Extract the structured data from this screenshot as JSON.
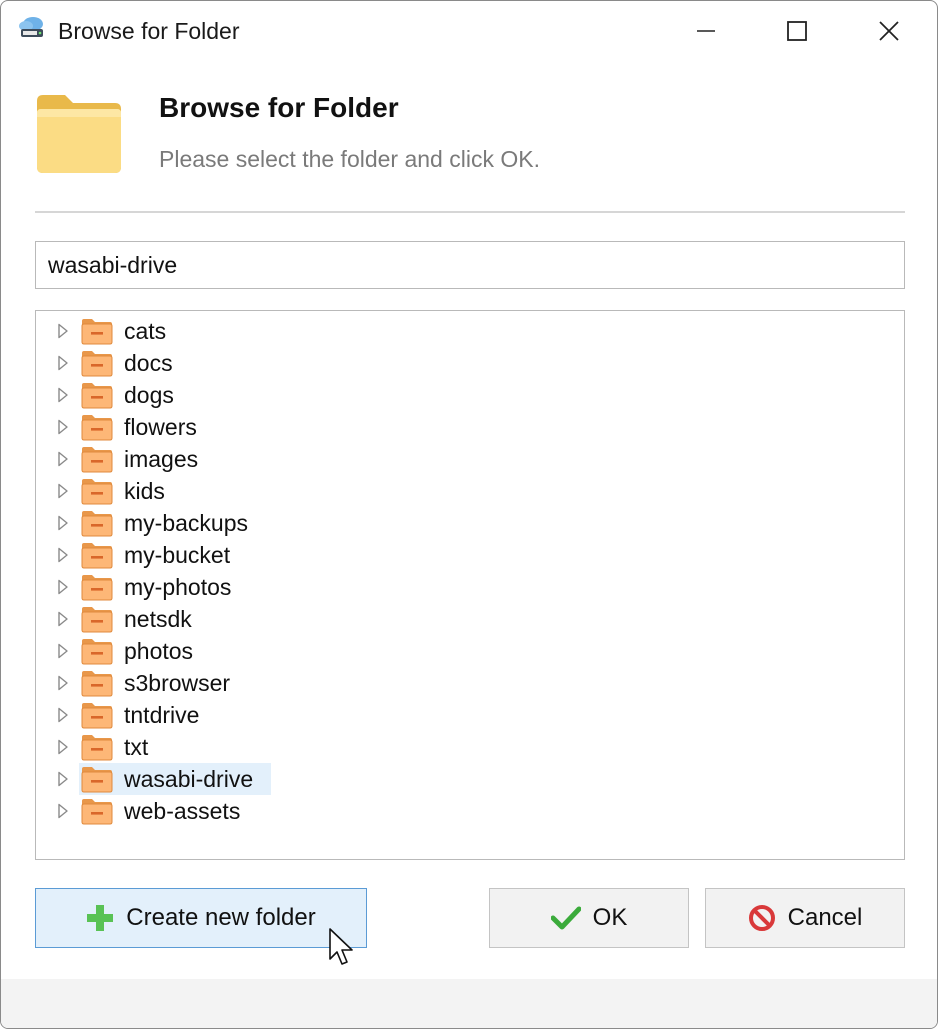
{
  "window": {
    "title": "Browse for Folder",
    "controls": [
      "minimize",
      "maximize",
      "close"
    ]
  },
  "header": {
    "title": "Browse for Folder",
    "subtitle": "Please select the folder and click OK.",
    "icon": "folder-icon"
  },
  "path_input": {
    "value": "wasabi-drive"
  },
  "tree": {
    "selected": "wasabi-drive",
    "items": [
      {
        "label": "cats"
      },
      {
        "label": "docs"
      },
      {
        "label": "dogs"
      },
      {
        "label": "flowers"
      },
      {
        "label": "images"
      },
      {
        "label": "kids"
      },
      {
        "label": "my-backups"
      },
      {
        "label": "my-bucket"
      },
      {
        "label": "my-photos"
      },
      {
        "label": "netsdk"
      },
      {
        "label": "photos"
      },
      {
        "label": "s3browser"
      },
      {
        "label": "tntdrive"
      },
      {
        "label": "txt"
      },
      {
        "label": "wasabi-drive"
      },
      {
        "label": "web-assets"
      }
    ]
  },
  "buttons": {
    "create_label": "Create new folder",
    "ok_label": "OK",
    "cancel_label": "Cancel"
  },
  "colors": {
    "accent": "#5b9bd5",
    "selection": "#e3f0fb",
    "folder_fill": "#fdb777",
    "header_folder": "#f9d97a",
    "ok_check": "#3bab3b",
    "cancel_red": "#d9393a",
    "plus_green": "#59c255"
  }
}
